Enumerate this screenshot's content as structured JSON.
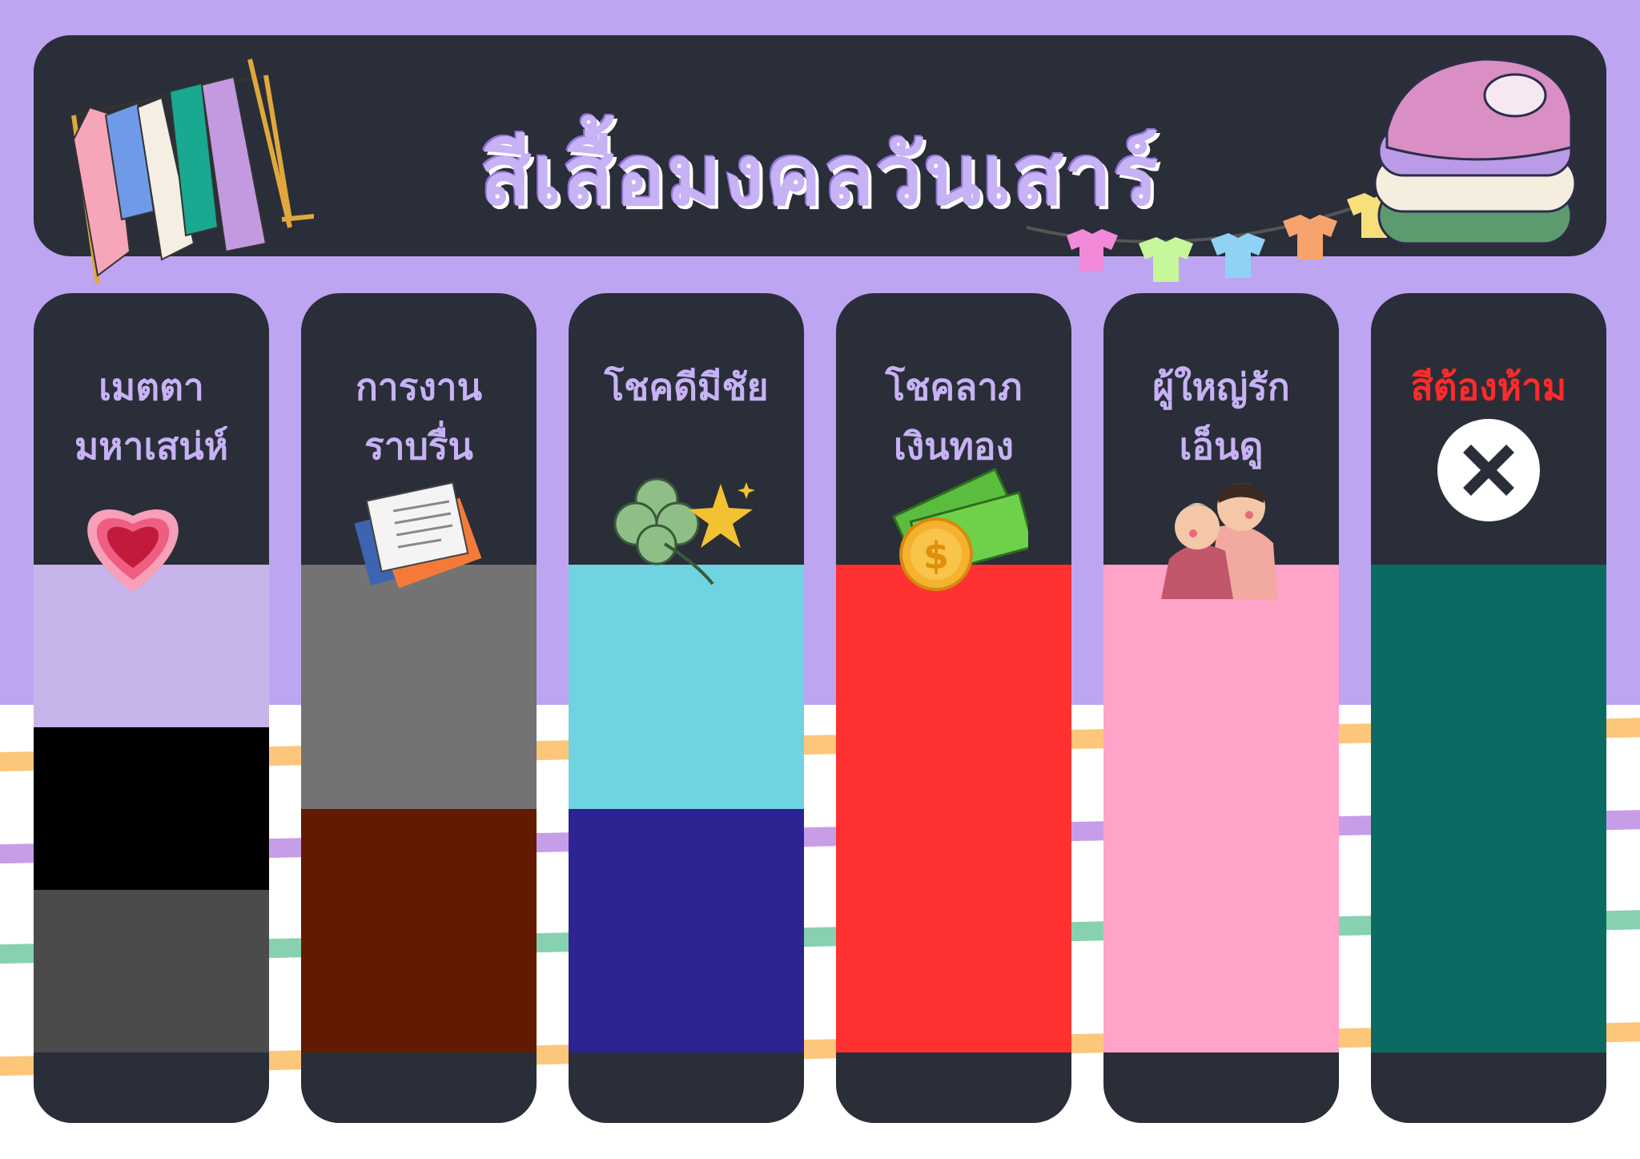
{
  "title": "สีเสื้อมงคลวันเสาร์",
  "columns": [
    {
      "line1": "เมตตา",
      "line2": "มหาเสน่ห์",
      "icon": "heart-icon",
      "forbidden": false,
      "colors": [
        "#c6b4ea",
        "#000000",
        "#4b4b4b"
      ]
    },
    {
      "line1": "การงาน",
      "line2": "ราบรื่น",
      "icon": "documents-icon",
      "forbidden": false,
      "colors": [
        "#737373",
        "#621a00"
      ]
    },
    {
      "line1": "โชคดีมีชัย",
      "line2": "",
      "icon": "clover-star-icon",
      "forbidden": false,
      "colors": [
        "#6fd3e1",
        "#2e2393"
      ]
    },
    {
      "line1": "โชคลาภ",
      "line2": "เงินทอง",
      "icon": "money-coin-icon",
      "forbidden": false,
      "colors": [
        "#ff3131"
      ]
    },
    {
      "line1": "ผู้ใหญ่รัก",
      "line2": "เอ็นดู",
      "icon": "elderly-couple-icon",
      "forbidden": false,
      "colors": [
        "#ffa3c8"
      ]
    },
    {
      "line1": "สีต้องห้าม",
      "line2": "",
      "icon": "x-circle-icon",
      "forbidden": true,
      "colors": [
        "#0b6b63"
      ]
    }
  ]
}
